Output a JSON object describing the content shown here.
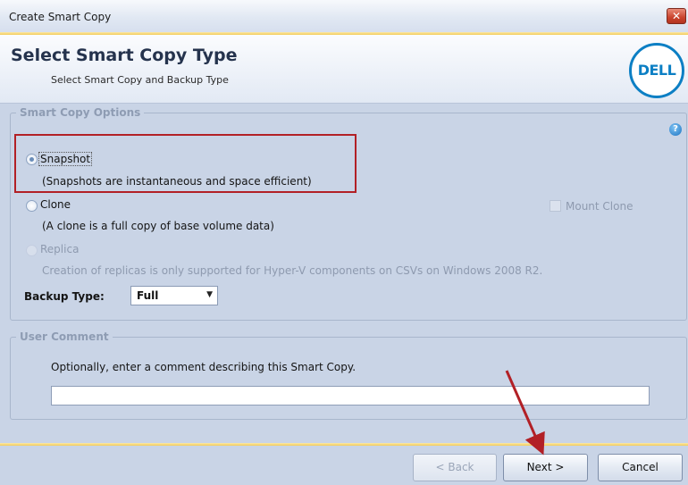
{
  "window": {
    "title": "Create Smart Copy",
    "close_glyph": "✕"
  },
  "header": {
    "title": "Select Smart Copy Type",
    "subtitle": "Select Smart Copy and Backup Type",
    "logo_text": "DELL",
    "logo_color": "#0c7fc4"
  },
  "options": {
    "legend": "Smart Copy Options",
    "help_icon": "help-icon",
    "snapshot": {
      "label": "Snapshot",
      "desc": "(Snapshots are instantaneous and space efficient)",
      "selected": true
    },
    "clone": {
      "label": "Clone",
      "desc": "(A clone is a full copy of base volume data)",
      "selected": false
    },
    "mount_clone": {
      "label": "Mount Clone",
      "checked": false,
      "enabled": false
    },
    "replica": {
      "label": "Replica",
      "desc": "Creation of replicas is only supported for Hyper-V components on CSVs on Windows 2008 R2.",
      "enabled": false
    },
    "backup_type": {
      "label": "Backup Type:",
      "value": "Full"
    }
  },
  "comment": {
    "legend": "User Comment",
    "prompt": "Optionally, enter a comment describing this Smart Copy.",
    "value": ""
  },
  "buttons": {
    "back": "< Back",
    "next": "Next >",
    "cancel": "Cancel"
  },
  "annotations": {
    "highlight_color": "#b22026"
  }
}
